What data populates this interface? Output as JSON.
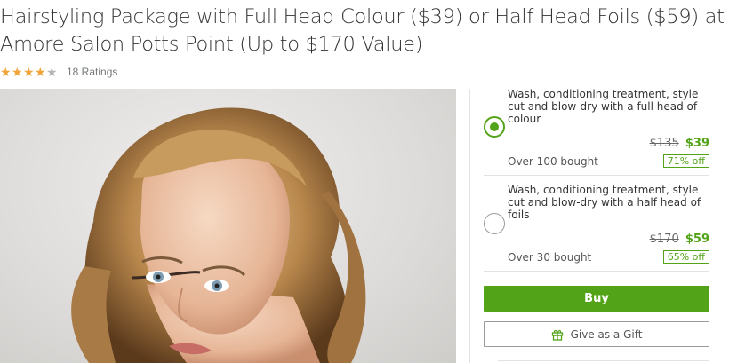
{
  "deal": {
    "title": "Hairstyling Package with Full Head Colour ($39) or Half Head Foils ($59) at Amore Salon Potts Point (Up to $170 Value)",
    "rating": {
      "value": 4,
      "max": 5,
      "count_text": "18 Ratings"
    }
  },
  "options": [
    {
      "description": "Wash, conditioning treatment, style cut and blow-dry with a full head of colour",
      "old_price": "$135",
      "new_price": "$39",
      "bought": "Over 100 bought",
      "discount": "71% off",
      "selected": true
    },
    {
      "description": "Wash, conditioning treatment, style cut and blow-dry with a half head of foils",
      "old_price": "$170",
      "new_price": "$59",
      "bought": "Over 30 bought",
      "discount": "65% off",
      "selected": false
    }
  ],
  "actions": {
    "buy_label": "Buy",
    "gift_label": "Give as a Gift"
  },
  "colors": {
    "accent": "#53a318",
    "star": "#f2a33a",
    "star_empty": "#b5b5b5"
  },
  "icons": {
    "gift": "gift-icon",
    "radio_selected": "radio-selected-icon",
    "radio": "radio-icon"
  }
}
